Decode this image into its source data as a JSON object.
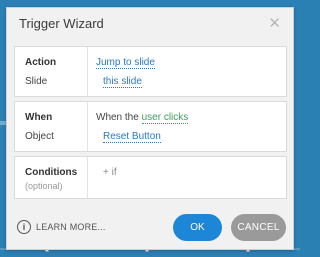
{
  "dialog": {
    "title": "Trigger Wizard",
    "close_icon": "close-icon"
  },
  "action_panel": {
    "action_label": "Action",
    "action_value": "Jump to slide",
    "slide_label": "Slide",
    "slide_value": "this slide"
  },
  "when_panel": {
    "when_label": "When",
    "when_prefix": "When the ",
    "when_value": "user clicks",
    "object_label": "Object",
    "object_value": "Reset Button"
  },
  "conditions_panel": {
    "conditions_label": "Conditions",
    "optional_label": "(optional)",
    "add_condition": "+ if"
  },
  "footer": {
    "learn_more": "LEARN MORE...",
    "info_icon": "info-icon",
    "ok_label": "OK",
    "cancel_label": "CANCEL"
  },
  "colors": {
    "backdrop": "#2b80b6",
    "link": "#2c78c5",
    "trigger_link": "#3d9d5b",
    "ok_button": "#1e86d6",
    "cancel_button": "#9a9a9a"
  }
}
